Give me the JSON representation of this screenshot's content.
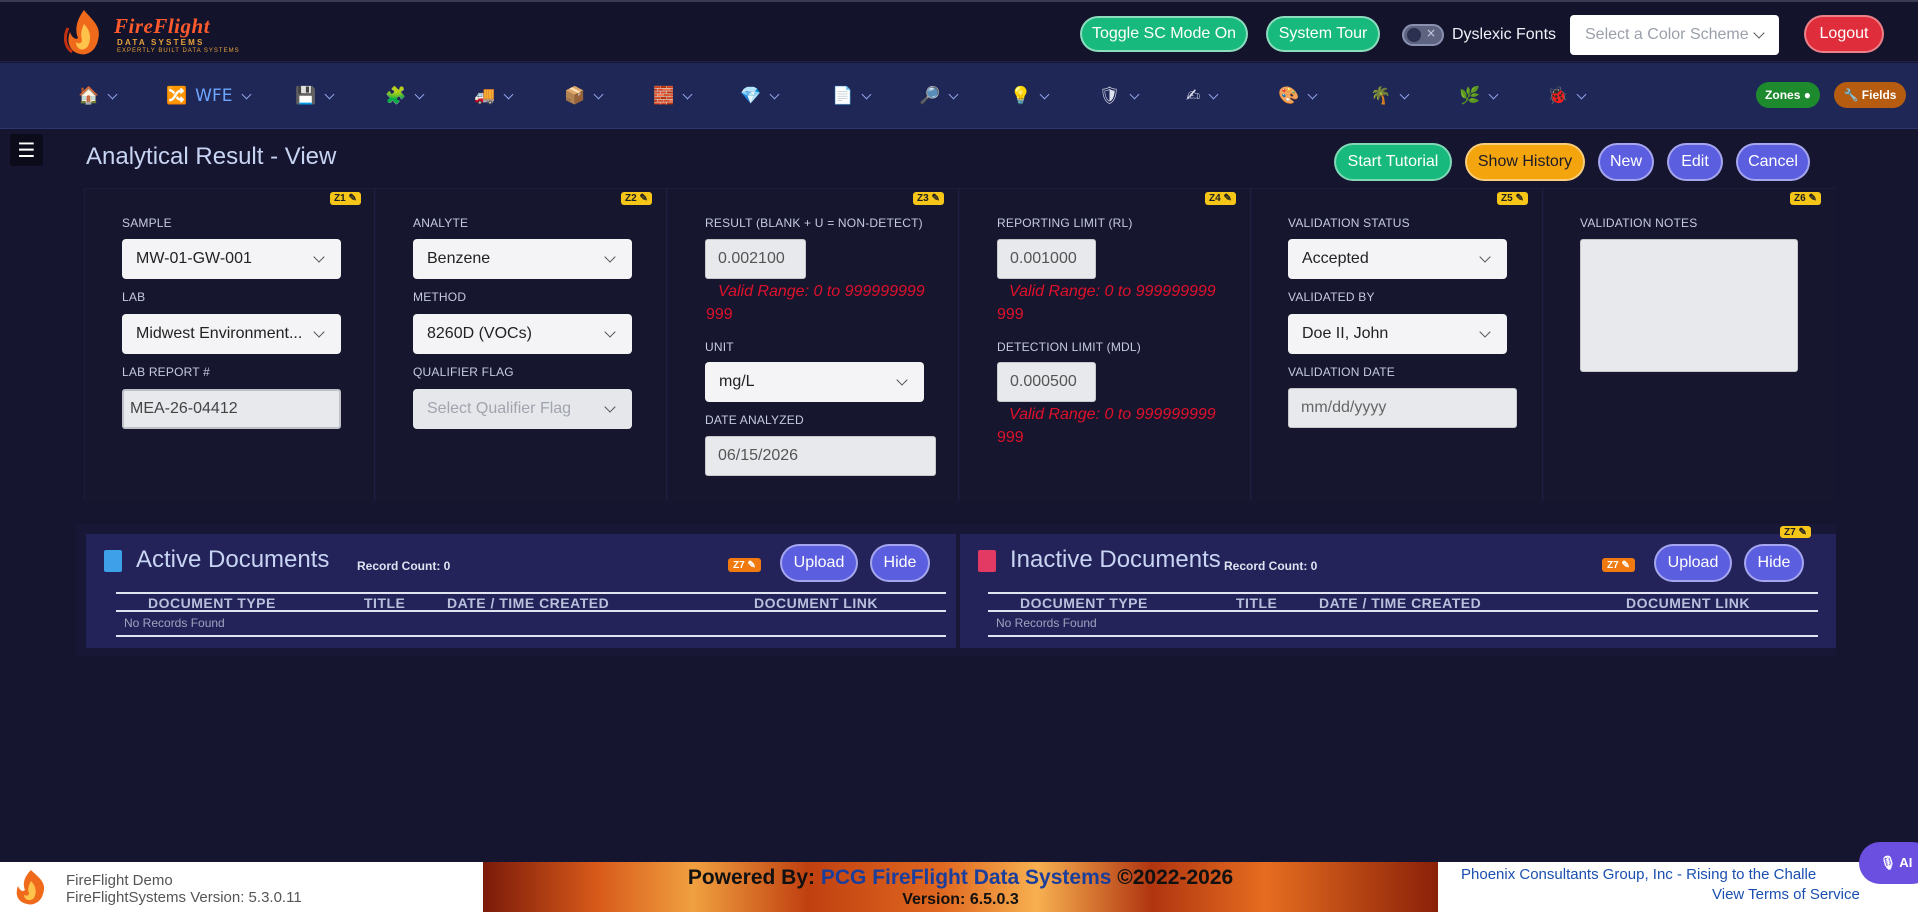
{
  "app": {
    "brand": "FireFlight",
    "brand_sub": "DATA SYSTEMS",
    "brand_tag": "EXPERTLY BUILT DATA SYSTEMS"
  },
  "topbar": {
    "toggle_sc": "Toggle SC Mode On",
    "system_tour": "System Tour",
    "dyslexic": "Dyslexic Fonts",
    "color_scheme_placeholder": "Select a Color Scheme",
    "logout": "Logout"
  },
  "nav": {
    "items": [
      {
        "icon": "home-icon",
        "glyph": "🏠"
      },
      {
        "icon": "shuffle-icon",
        "glyph": "🔀",
        "label": "WFE"
      },
      {
        "icon": "save-icon",
        "glyph": "💾"
      },
      {
        "icon": "puzzle-icon",
        "glyph": "🧩"
      },
      {
        "icon": "truck-icon",
        "glyph": "🚚"
      },
      {
        "icon": "package-icon",
        "glyph": "📦"
      },
      {
        "icon": "brick-icon",
        "glyph": "🧱"
      },
      {
        "icon": "gem-icon",
        "glyph": "💎"
      },
      {
        "icon": "document-icon",
        "glyph": "📄"
      },
      {
        "icon": "magnifier-icon",
        "glyph": "🔎"
      },
      {
        "icon": "lightbulb-icon",
        "glyph": "💡"
      },
      {
        "icon": "shield-icon",
        "glyph": "🛡"
      },
      {
        "icon": "writing-hand-icon",
        "glyph": "✍"
      },
      {
        "icon": "shapes-icon",
        "glyph": "🎨"
      },
      {
        "icon": "tree-icon",
        "glyph": "🌴"
      },
      {
        "icon": "herb-icon",
        "glyph": "🌿"
      },
      {
        "icon": "bug-icon",
        "glyph": "🐞"
      }
    ],
    "zones_label": "Zones ●",
    "fields_label": "🔧 Fields"
  },
  "page": {
    "title": "Analytical Result - View",
    "buttons": {
      "start_tutorial": "Start Tutorial",
      "show_history": "Show History",
      "new": "New",
      "edit": "Edit",
      "cancel": "Cancel"
    }
  },
  "form": {
    "zones": [
      "Z1 ✎",
      "Z2 ✎",
      "Z3 ✎",
      "Z4 ✎",
      "Z5 ✎",
      "Z6 ✎"
    ],
    "sample_label": "SAMPLE",
    "sample_value": "MW-01-GW-001",
    "lab_label": "LAB",
    "lab_value": "Midwest Environment...",
    "lab_report_label": "LAB REPORT #",
    "lab_report_value": "MEA-26-04412",
    "analyte_label": "ANALYTE",
    "analyte_value": "Benzene",
    "method_label": "METHOD",
    "method_value": "8260D (VOCs)",
    "qualifier_label": "QUALIFIER FLAG",
    "qualifier_placeholder": "Select Qualifier Flag",
    "result_label": "RESULT (BLANK + U = NON-DETECT)",
    "result_value": "0.002100",
    "valid_range_1": "Valid Range: 0 to 999999999",
    "valid_range_2": "999",
    "unit_label": "UNIT",
    "unit_value": "mg/L",
    "date_analyzed_label": "DATE ANALYZED",
    "date_analyzed_value": "06/15/2026",
    "rl_label": "REPORTING LIMIT (RL)",
    "rl_value": "0.001000",
    "mdl_label": "DETECTION LIMIT (MDL)",
    "mdl_value": "0.000500",
    "validation_status_label": "VALIDATION STATUS",
    "validation_status_value": "Accepted",
    "validated_by_label": "VALIDATED BY",
    "validated_by_value": "Doe II, John",
    "validation_date_label": "VALIDATION DATE",
    "validation_date_placeholder": "mm/dd/yyyy",
    "notes_label": "VALIDATION NOTES"
  },
  "documents": {
    "active_title": "Active Documents",
    "inactive_title": "Inactive Documents",
    "record_count": "Record Count: 0",
    "zone": "Z7 ✎",
    "upload": "Upload",
    "hide": "Hide",
    "columns": [
      "DOCUMENT TYPE",
      "TITLE",
      "DATE / TIME CREATED",
      "DOCUMENT LINK"
    ],
    "empty": "No Records Found"
  },
  "footer": {
    "line1": "FireFlight Demo",
    "line2": "FireFlightSystems Version: 5.3.0.11",
    "powered_prefix": "Powered By: ",
    "powered_name": "PCG FireFlight Data Systems",
    "powered_suffix": " ©2022-2026",
    "version": "Version: 6.5.0.3",
    "right1": "Phoenix Consultants Group, Inc - Rising to the Challe",
    "right2": "View Terms of Service",
    "ai": "🎙 AI"
  }
}
